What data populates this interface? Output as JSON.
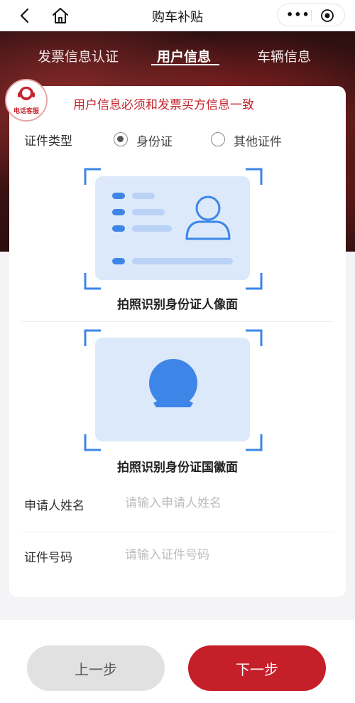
{
  "nav": {
    "title": "购车补贴",
    "back_icon": "chevron-left-icon",
    "home_icon": "home-icon",
    "more_icon": "more-dots-icon",
    "close_icon": "target-icon"
  },
  "tabs": [
    {
      "label": "发票信息认证"
    },
    {
      "label": "用户信息",
      "active": true
    },
    {
      "label": "车辆信息"
    }
  ],
  "service": {
    "label": "电话客服",
    "icon": "headset-agent-icon"
  },
  "notice": "用户信息必须和发票买方信息一致",
  "id_type": {
    "label": "证件类型",
    "options": [
      "身份证",
      "其他证件"
    ],
    "selected": "身份证"
  },
  "upload_front": {
    "caption": "拍照识别身份证人像面",
    "icon": "id-card-portrait-icon"
  },
  "upload_back": {
    "caption": "拍照识别身份证国徽面",
    "icon": "id-card-emblem-icon"
  },
  "fields": {
    "name": {
      "label": "申请人姓名",
      "placeholder": "请输入申请人姓名",
      "value": ""
    },
    "id_number": {
      "label": "证件号码",
      "placeholder": "请输入证件号码",
      "value": ""
    }
  },
  "buttons": {
    "prev": "上一步",
    "next": "下一步"
  },
  "colors": {
    "accent": "#c51f2a",
    "card_blue": "#dce9fb",
    "icon_blue": "#3d86e8"
  }
}
